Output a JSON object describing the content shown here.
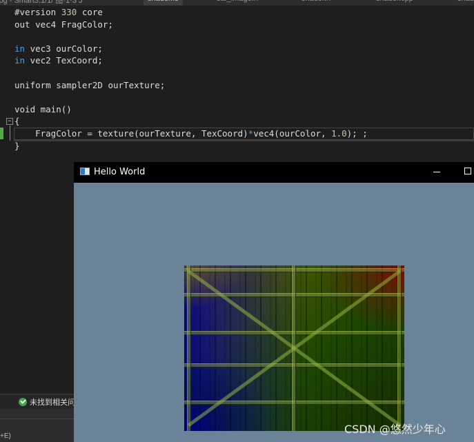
{
  "tabs": [
    {
      "label": "jpg - Smart3.1/1/ 图·1·3 J",
      "active": false
    },
    {
      "label": "shader.fs",
      "active": true
    },
    {
      "label": "stb_image.h",
      "active": false
    },
    {
      "label": "shader.h",
      "active": false
    },
    {
      "label": "shader.cpp",
      "active": false
    },
    {
      "label": "shad",
      "active": false
    }
  ],
  "editor": {
    "lines": [
      {
        "tokens": [
          {
            "t": "#version ",
            "c": "ty"
          },
          {
            "t": "330",
            "c": "num"
          },
          {
            "t": " core",
            "c": "ty"
          }
        ]
      },
      {
        "tokens": [
          {
            "t": "out vec4 FragColor;",
            "c": "ty"
          }
        ]
      },
      {
        "tokens": []
      },
      {
        "tokens": [
          {
            "t": "in",
            "c": "kw"
          },
          {
            "t": " vec3 ourColor;",
            "c": "ty"
          }
        ]
      },
      {
        "tokens": [
          {
            "t": "in",
            "c": "kw"
          },
          {
            "t": " vec2 TexCoord;",
            "c": "ty"
          }
        ]
      },
      {
        "tokens": []
      },
      {
        "tokens": [
          {
            "t": "uniform sampler2D ourTexture;",
            "c": "ty"
          }
        ]
      },
      {
        "tokens": []
      },
      {
        "tokens": [
          {
            "t": "void main()",
            "c": "ty"
          }
        ]
      },
      {
        "tokens": [
          {
            "t": "{",
            "c": "ty"
          }
        ]
      },
      {
        "tokens": [
          {
            "t": "    FragColor = texture(ourTexture, TexCoord)",
            "c": "ty"
          },
          {
            "t": "*",
            "c": "kw"
          },
          {
            "t": "vec4(ourColor, ",
            "c": "ty"
          },
          {
            "t": "1.0",
            "c": "num"
          },
          {
            "t": "); ;",
            "c": "ty"
          }
        ]
      },
      {
        "tokens": [
          {
            "t": "}",
            "c": "ty"
          }
        ]
      }
    ],
    "fold_glyph": "−"
  },
  "status": {
    "message": "未找到相关问题",
    "shortcut_hint": "+E)"
  },
  "gl_window": {
    "title": "Hello World",
    "clear_color": "#6a8399"
  },
  "watermark": "CSDN @悠然少年心"
}
